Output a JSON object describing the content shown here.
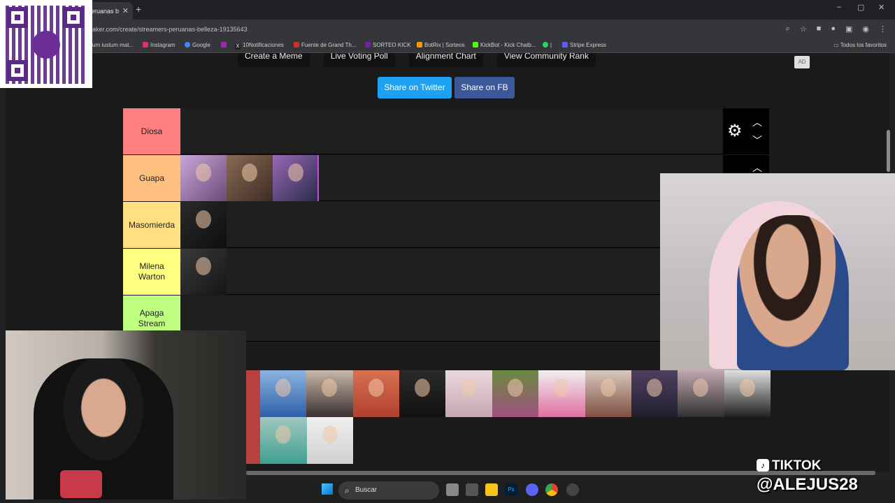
{
  "browser": {
    "tab_title": "eruanas b",
    "url": "aker.com/create/streamers-peruanas-belleza-19135643",
    "window_controls": [
      "–",
      "▢",
      "✕"
    ],
    "bookmarks": [
      {
        "label": "um iustum mat...",
        "color": "#777777"
      },
      {
        "label": "Instagram",
        "color": "#e1306c"
      },
      {
        "label": "Google",
        "color": "#4285f4"
      },
      {
        "label": "",
        "color": "#9c27b0"
      },
      {
        "label": "10Notificaciones",
        "color": "#222222"
      },
      {
        "label": "Fuente de Grand Th...",
        "color": "#d32f2f"
      },
      {
        "label": "SORTEO KICK",
        "color": "#7b1fa2"
      },
      {
        "label": "BotRix | Sorteos",
        "color": "#ff9800"
      },
      {
        "label": "KickBot - Kick Chatb...",
        "color": "#53fc18"
      },
      {
        "label": "|",
        "color": "#25d366"
      },
      {
        "label": "Stripe Express",
        "color": "#635bff"
      }
    ],
    "bookmarks_all": "Todos los favoritos"
  },
  "page": {
    "top_buttons": [
      "Create a Meme",
      "Live Voting Poll",
      "Alignment Chart",
      "View Community Rank"
    ],
    "ad_label": "AD",
    "share_twitter": "Share on Twitter",
    "share_fb": "Share on FB",
    "tiers": [
      {
        "label": "Diosa",
        "color": "#ff7f7f",
        "count": 0
      },
      {
        "label": "Guapa",
        "color": "#ffbf7f",
        "count": 3
      },
      {
        "label": "Masomierda",
        "color": "#ffdf7f",
        "count": 1
      },
      {
        "label": "Milena\nWarton",
        "color": "#ffff7f",
        "count": 1
      },
      {
        "label": "Apaga\nStream",
        "color": "#bfff7f",
        "count": 0
      }
    ]
  },
  "overlay": {
    "qr_brand": "yape",
    "tiktok_label": "TIKTOK",
    "tiktok_handle": "@ALEJUS28"
  },
  "taskbar": {
    "search_placeholder": "Buscar"
  },
  "colors": {
    "twitter": "#1da1f2",
    "facebook": "#3b5998"
  }
}
